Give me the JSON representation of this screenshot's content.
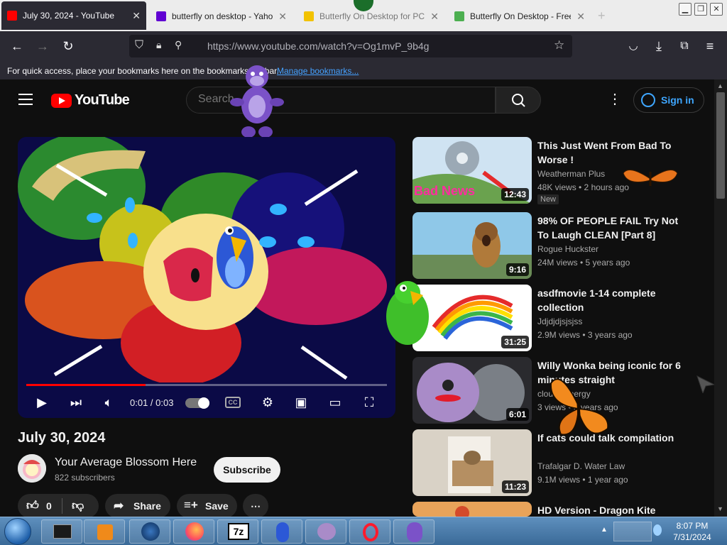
{
  "browser": {
    "tabs": [
      {
        "title": "July 30, 2024 - YouTube",
        "active": true,
        "favicon_color": "#ff0000"
      },
      {
        "title": "butterfly on desktop - Yahoo",
        "active": false,
        "favicon_color": "#6001d2"
      },
      {
        "title": "Butterfly On Desktop for PC",
        "active": false,
        "favicon_color": "#f2c200"
      },
      {
        "title": "Butterfly On Desktop - Freew",
        "active": false,
        "favicon_color": "#4caf50"
      }
    ],
    "url": "https://www.youtube.com/watch?v=Og1mvP_9b4g",
    "bookmarks_text": "For quick access, place your bookmarks here on the bookmarks toolbar.",
    "manage_bookmarks": "Manage bookmarks..."
  },
  "yt": {
    "logo": "YouTube",
    "search_placeholder": "Search",
    "sign_in": "Sign in",
    "accent": "#ff0000",
    "link_blue": "#3ea6ff"
  },
  "player": {
    "time": "0:01 / 0:03",
    "progress": 0.33,
    "cc": "CC"
  },
  "video": {
    "title": "July 30, 2024",
    "channel": "Your Average Blossom Here",
    "subscribers": "822 subscribers",
    "subscribe": "Subscribe",
    "likes": "0",
    "share": "Share",
    "save": "Save"
  },
  "recommended": [
    {
      "title": "This Just Went From Bad To Worse !",
      "channel": "Weatherman Plus",
      "meta": "48K views • 2 hours ago",
      "duration": "12:43",
      "badge": "New",
      "thumb_text": "Bad News"
    },
    {
      "title": "98% OF PEOPLE FAIL Try Not To Laugh CLEAN [Part 8]",
      "channel": "Rogue Huckster",
      "meta": "24M views • 5 years ago",
      "duration": "9:16"
    },
    {
      "title": "asdfmovie 1-14 complete collection",
      "channel": "Jdjdjdjsjsjss",
      "meta": "2.9M views • 3 years ago",
      "duration": "31:25"
    },
    {
      "title": "Willy Wonka being iconic for 6 minutes straight",
      "channel": "cloudy energy",
      "meta": "3 views • 3 years ago",
      "duration": "6:01"
    },
    {
      "title": "If cats could talk compilation",
      "channel": "Trafalgar D. Water Law",
      "meta": "9.1M views • 1 year ago",
      "duration": "11:23"
    },
    {
      "title": "HD Version - Dragon Kite",
      "channel": "",
      "meta": "",
      "duration": ""
    }
  ],
  "taskbar": {
    "time": "8:07 PM",
    "date": "7/31/2024",
    "zip_label": "7z"
  }
}
